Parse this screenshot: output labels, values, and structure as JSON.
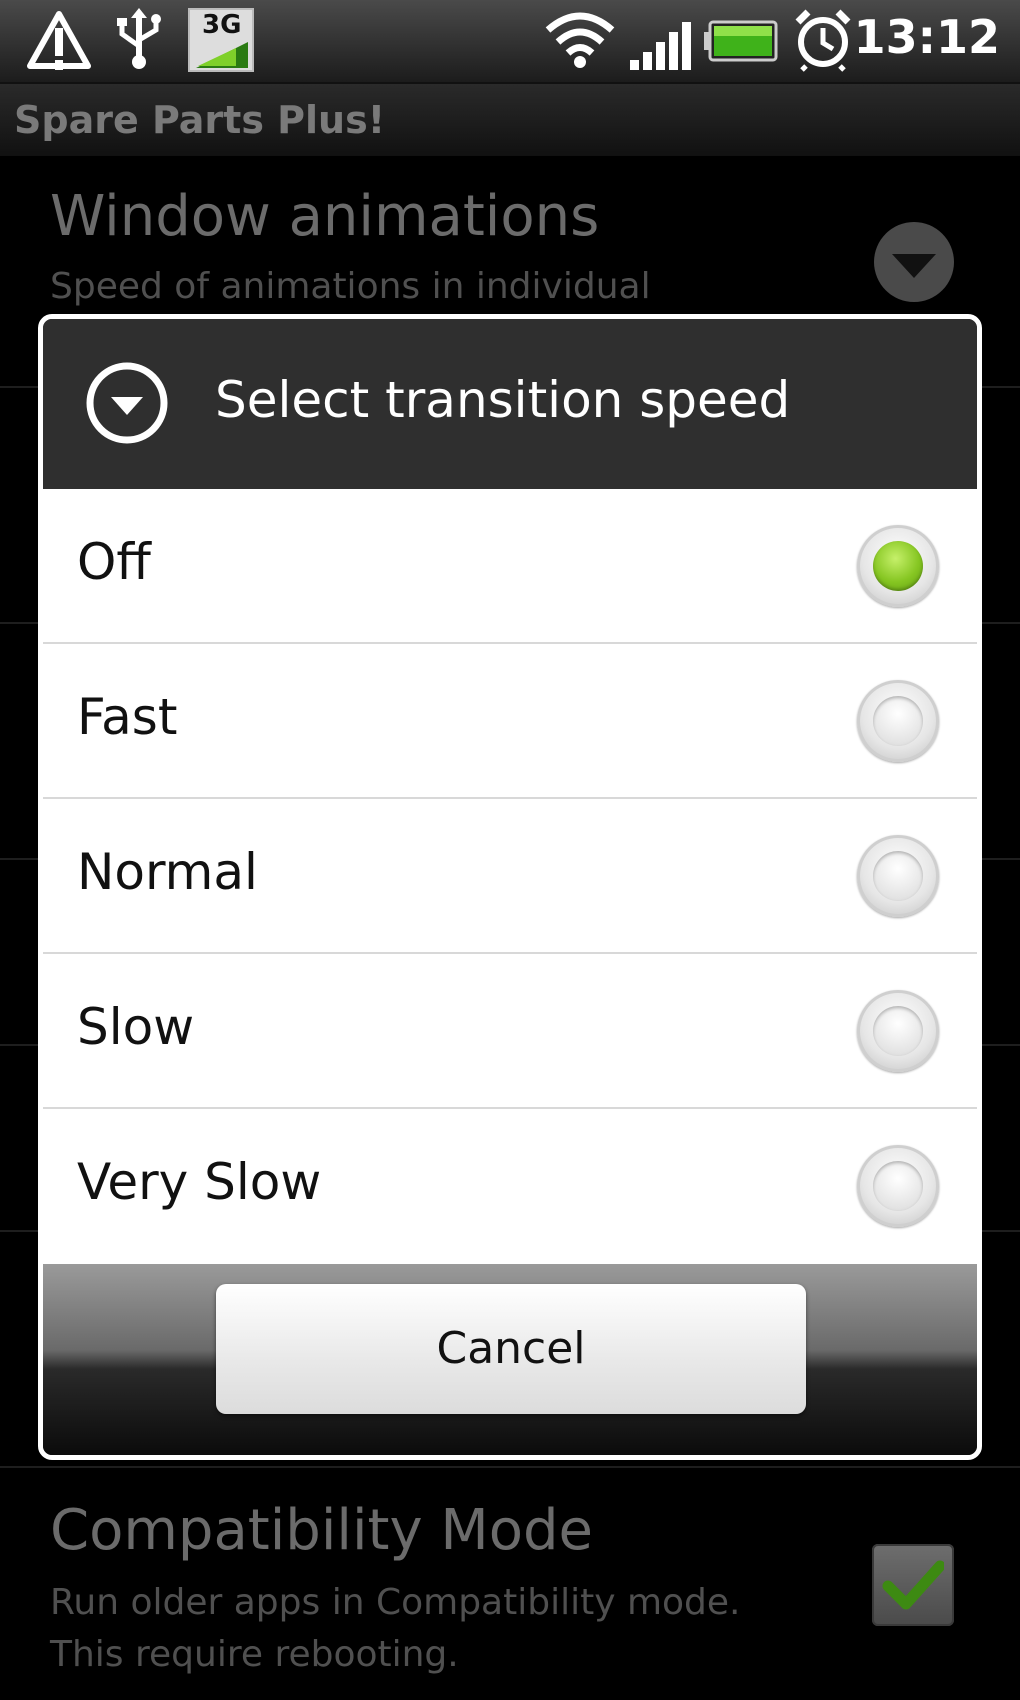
{
  "status_bar": {
    "network_type": "3G",
    "time": "13:12",
    "icons": [
      "alert-icon",
      "usb-icon",
      "network-3g-icon",
      "wifi-icon",
      "signal-icon",
      "battery-icon",
      "alarm-icon"
    ]
  },
  "app": {
    "title": "Spare Parts Plus!",
    "preferences": [
      {
        "title": "Window animations",
        "summary": "Speed of animations in individual"
      },
      {
        "title": "Compatibility Mode",
        "summary_line1": "Run older apps in Compatibility mode.",
        "summary_line2": "This require rebooting.",
        "checked": true
      }
    ]
  },
  "dialog": {
    "title": "Select transition speed",
    "options": [
      {
        "label": "Off",
        "selected": true
      },
      {
        "label": "Fast",
        "selected": false
      },
      {
        "label": "Normal",
        "selected": false
      },
      {
        "label": "Slow",
        "selected": false
      },
      {
        "label": "Very Slow",
        "selected": false
      }
    ],
    "cancel_label": "Cancel"
  },
  "colors": {
    "radio_selected": "#86c622",
    "dialog_header": "#2f2f2f",
    "background": "#000000"
  }
}
